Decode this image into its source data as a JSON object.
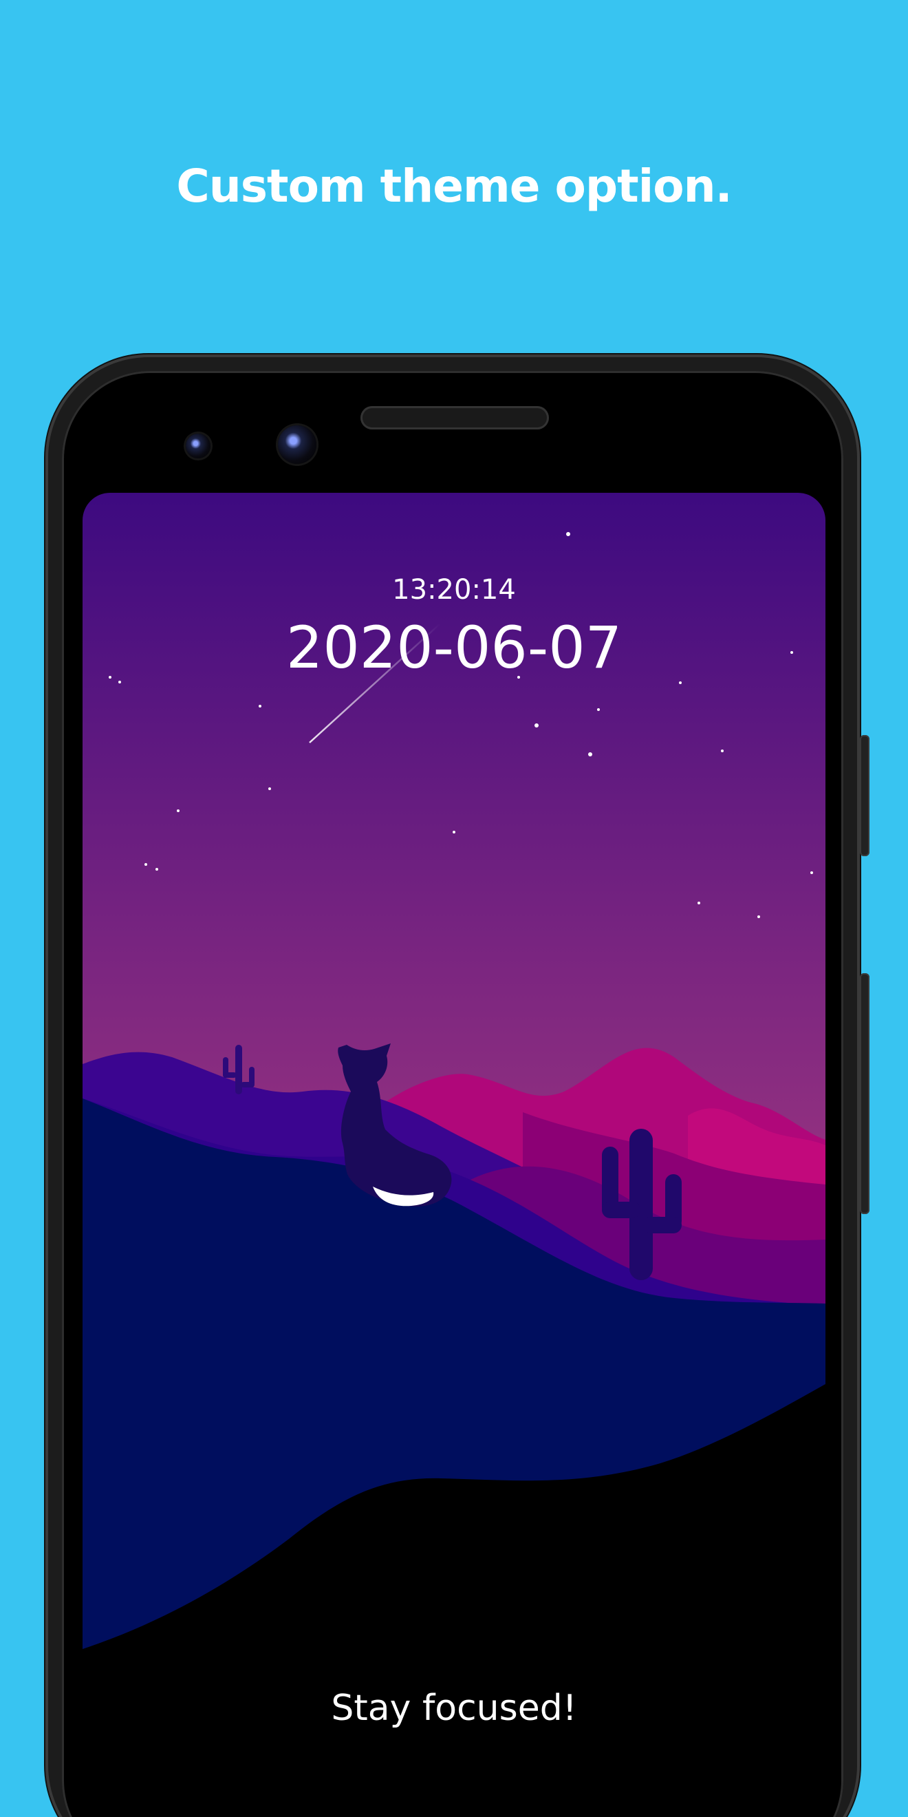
{
  "headline": "Custom theme option.",
  "clock": {
    "time": "13:20:14",
    "date": "2020-06-07"
  },
  "tagline": "Stay focused!",
  "colors": {
    "background": "#38c4f1",
    "sky_top": "#3d0a80",
    "sky_bottom": "#dc4e7a",
    "foreground_hill": "#000e5e"
  }
}
